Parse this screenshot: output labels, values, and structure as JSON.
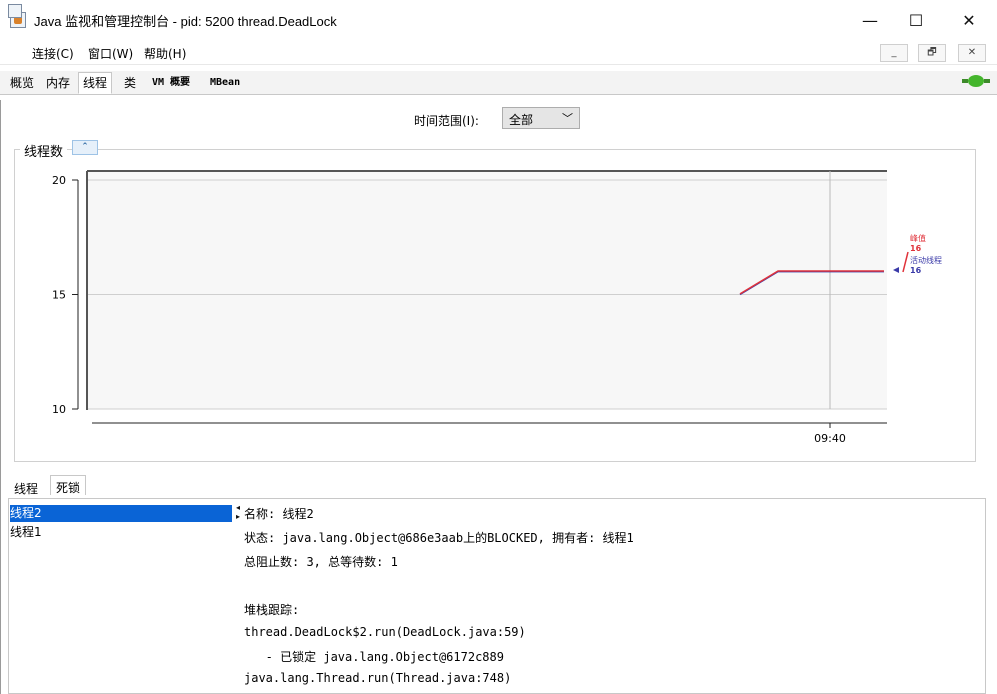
{
  "window": {
    "title": "Java 监视和管理控制台 - pid: 5200 thread.DeadLock",
    "minimize": "—",
    "maximize": "☐",
    "close": "✕"
  },
  "menu": {
    "items": [
      "连接(C)",
      "窗口(W)",
      "帮助(H)"
    ],
    "mdi_buttons": [
      "_",
      "🗗",
      "✕"
    ]
  },
  "tabs": [
    "概览",
    "内存",
    "线程",
    "类",
    "VM 概要",
    "MBean"
  ],
  "active_tab": "线程",
  "time_range": {
    "label": "时间范围(I):",
    "value": "全部"
  },
  "chart": {
    "panel_title": "线程数",
    "collapse": "⌃",
    "legend": {
      "peak_label": "峰值",
      "peak_value": "16",
      "live_label": "活动线程",
      "live_value": "16",
      "peak_color": "#e0323a",
      "live_color": "#3a3aa8"
    }
  },
  "chart_data": {
    "type": "line",
    "title": "线程数",
    "x_tick_labels": [
      "09:40"
    ],
    "y_ticks": [
      10,
      15,
      20
    ],
    "ylim": [
      10,
      20
    ],
    "grid": true,
    "series": [
      {
        "name": "峰值",
        "color": "#e0323a",
        "x": [
          "t0",
          "t1",
          "t2"
        ],
        "values": [
          15,
          16,
          16
        ]
      },
      {
        "name": "活动线程",
        "color": "#3a3aa8",
        "x": [
          "t0",
          "t1",
          "t2"
        ],
        "values": [
          15,
          16,
          16
        ]
      }
    ]
  },
  "bottom_tabs": [
    "线程",
    "死锁"
  ],
  "active_bottom_tab": "死锁",
  "threads": [
    "线程2",
    "线程1"
  ],
  "selected_thread": "线程2",
  "details": {
    "lines": [
      "名称: 线程2",
      "状态: java.lang.Object@686e3aab上的BLOCKED, 拥有者: 线程1",
      "总阻止数: 3, 总等待数: 1",
      "",
      "堆栈跟踪:",
      "thread.DeadLock$2.run(DeadLock.java:59)",
      "   - 已锁定 java.lang.Object@6172c889",
      "java.lang.Thread.run(Thread.java:748)"
    ]
  }
}
